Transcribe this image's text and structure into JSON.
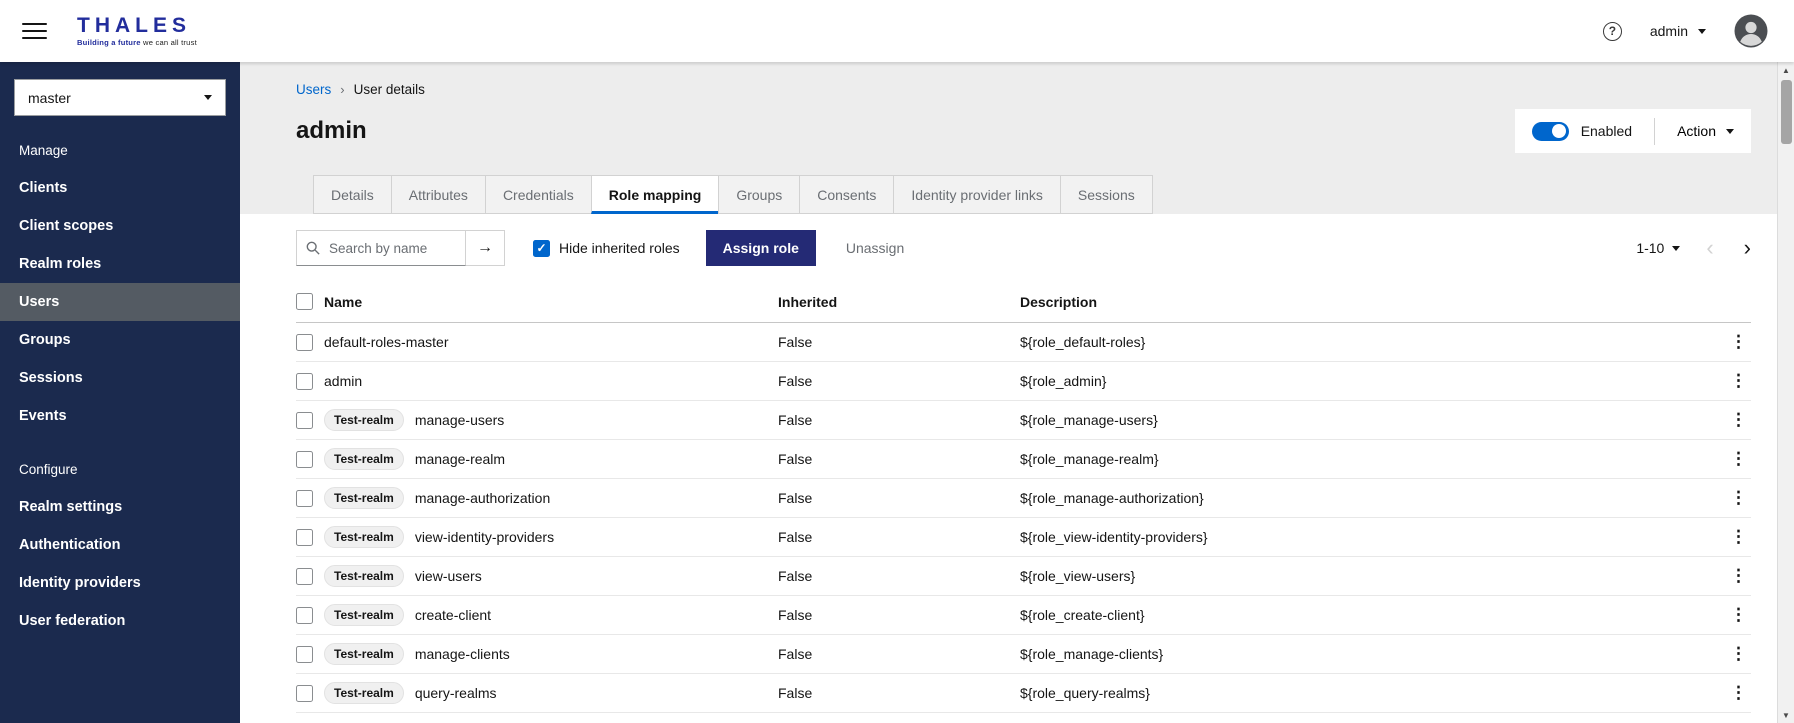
{
  "theme": {
    "accent_blue": "#0066cc",
    "brand_blue": "#222d9c",
    "sidebar_navy": "#1b2a4e",
    "sidebar_active_gray": "#545b63",
    "primary_button_navy": "#242a75",
    "content_gray": "#ededed",
    "text_dark": "#151515",
    "text_muted": "#6a6e73",
    "border_gray": "#d2d2d2"
  },
  "icons": {
    "kebab": "⋮",
    "arrow_right": "→",
    "chevron_left": "‹",
    "chevron_right": "›",
    "breadcrumb_separator": "›",
    "check": "✓",
    "question": "?",
    "scroll_up": "▲",
    "scroll_down": "▼"
  },
  "header": {
    "brand": {
      "name": "THALES",
      "tagline_blue": "Building a future",
      "tagline_dark": "we can all trust"
    },
    "user_menu": {
      "label": "admin"
    }
  },
  "sidebar": {
    "realm_selector": {
      "value": "master"
    },
    "sections": [
      {
        "label": "Manage",
        "items": [
          {
            "label": "Clients",
            "active": false
          },
          {
            "label": "Client scopes",
            "active": false
          },
          {
            "label": "Realm roles",
            "active": false
          },
          {
            "label": "Users",
            "active": true
          },
          {
            "label": "Groups",
            "active": false
          },
          {
            "label": "Sessions",
            "active": false
          },
          {
            "label": "Events",
            "active": false
          }
        ]
      },
      {
        "label": "Configure",
        "items": [
          {
            "label": "Realm settings",
            "active": false
          },
          {
            "label": "Authentication",
            "active": false
          },
          {
            "label": "Identity providers",
            "active": false
          },
          {
            "label": "User federation",
            "active": false
          }
        ]
      }
    ]
  },
  "main": {
    "breadcrumb": {
      "link": "Users",
      "current": "User details"
    },
    "page_title": "admin",
    "enabled_toggle": {
      "label": "Enabled",
      "on": true
    },
    "action_dropdown": {
      "label": "Action"
    },
    "tabs": [
      {
        "label": "Details",
        "active": false
      },
      {
        "label": "Attributes",
        "active": false
      },
      {
        "label": "Credentials",
        "active": false
      },
      {
        "label": "Role mapping",
        "active": true
      },
      {
        "label": "Groups",
        "active": false
      },
      {
        "label": "Consents",
        "active": false
      },
      {
        "label": "Identity provider links",
        "active": false
      },
      {
        "label": "Sessions",
        "active": false
      }
    ],
    "toolbar": {
      "search_placeholder": "Search by name",
      "hide_inherited_label": "Hide inherited roles",
      "hide_inherited_checked": true,
      "assign_role_label": "Assign role",
      "unassign_label": "Unassign",
      "pagination": {
        "range": "1-10"
      }
    },
    "table": {
      "columns": [
        "Name",
        "Inherited",
        "Description"
      ],
      "rows": [
        {
          "badge": "",
          "name": "default-roles-master",
          "inherited": "False",
          "description": "${role_default-roles}"
        },
        {
          "badge": "",
          "name": "admin",
          "inherited": "False",
          "description": "${role_admin}"
        },
        {
          "badge": "Test-realm",
          "name": "manage-users",
          "inherited": "False",
          "description": "${role_manage-users}"
        },
        {
          "badge": "Test-realm",
          "name": "manage-realm",
          "inherited": "False",
          "description": "${role_manage-realm}"
        },
        {
          "badge": "Test-realm",
          "name": "manage-authorization",
          "inherited": "False",
          "description": "${role_manage-authorization}"
        },
        {
          "badge": "Test-realm",
          "name": "view-identity-providers",
          "inherited": "False",
          "description": "${role_view-identity-providers}"
        },
        {
          "badge": "Test-realm",
          "name": "view-users",
          "inherited": "False",
          "description": "${role_view-users}"
        },
        {
          "badge": "Test-realm",
          "name": "create-client",
          "inherited": "False",
          "description": "${role_create-client}"
        },
        {
          "badge": "Test-realm",
          "name": "manage-clients",
          "inherited": "False",
          "description": "${role_manage-clients}"
        },
        {
          "badge": "Test-realm",
          "name": "query-realms",
          "inherited": "False",
          "description": "${role_query-realms}"
        }
      ]
    }
  }
}
